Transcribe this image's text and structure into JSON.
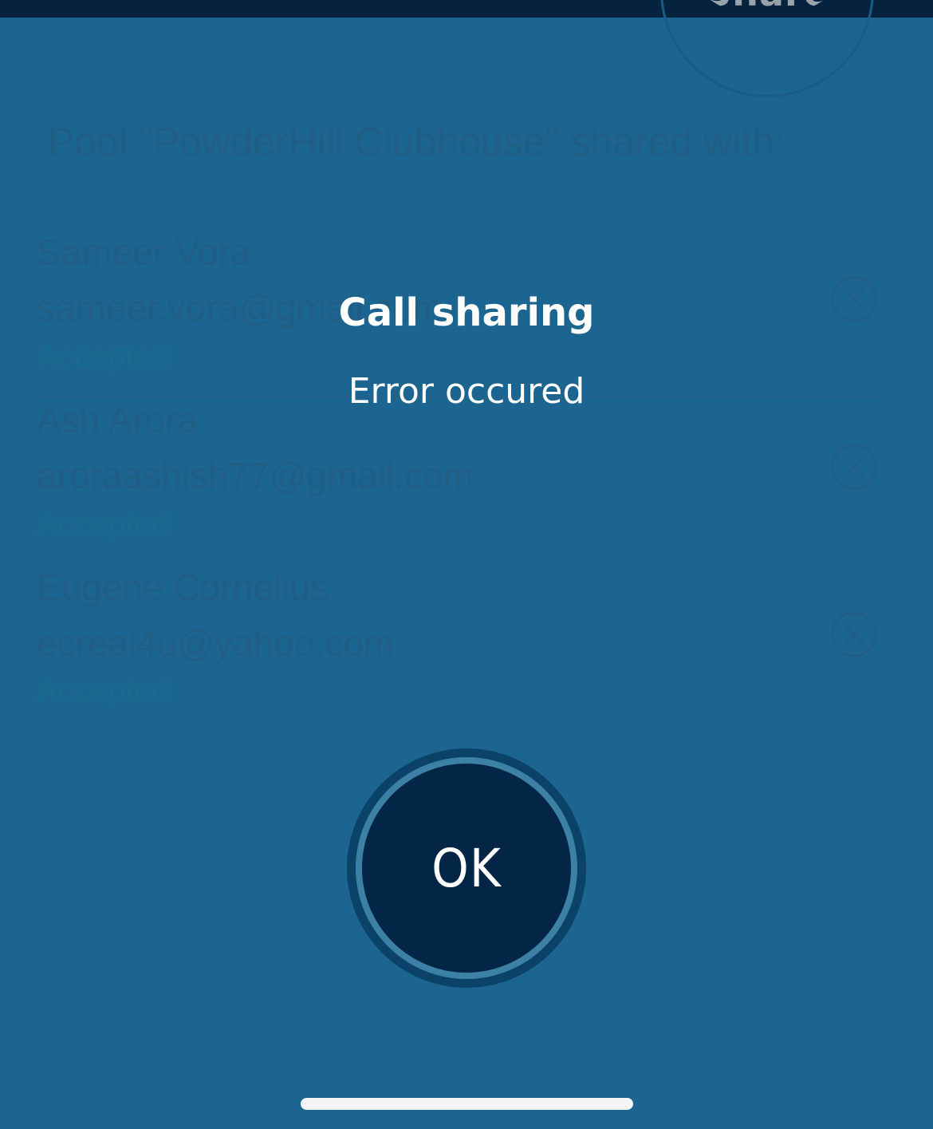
{
  "background_screen": {
    "share_button_label": "Share",
    "title": "Pool \"PowderHill Clubhouse\" shared with:",
    "shares": [
      {
        "name": "Sameer Vora",
        "email": "sameer.vora@gmail.com",
        "status": "Accepted"
      },
      {
        "name": "Ash Arora",
        "email": "aroraashish77@gmail.com",
        "status": "Accepted"
      },
      {
        "name": "Eugene Cornelius",
        "email": "ecreal4u@yahoo.com",
        "status": "Accepted"
      }
    ],
    "remove_icon": "circle-x-icon"
  },
  "dialog": {
    "title": "Call sharing",
    "message": "Error occured",
    "ok_label": "OK"
  },
  "colors": {
    "overlay_background": "#1d6591",
    "button_dark": "#042646",
    "button_ring": "#3d80a6",
    "text": "#ffffff"
  }
}
